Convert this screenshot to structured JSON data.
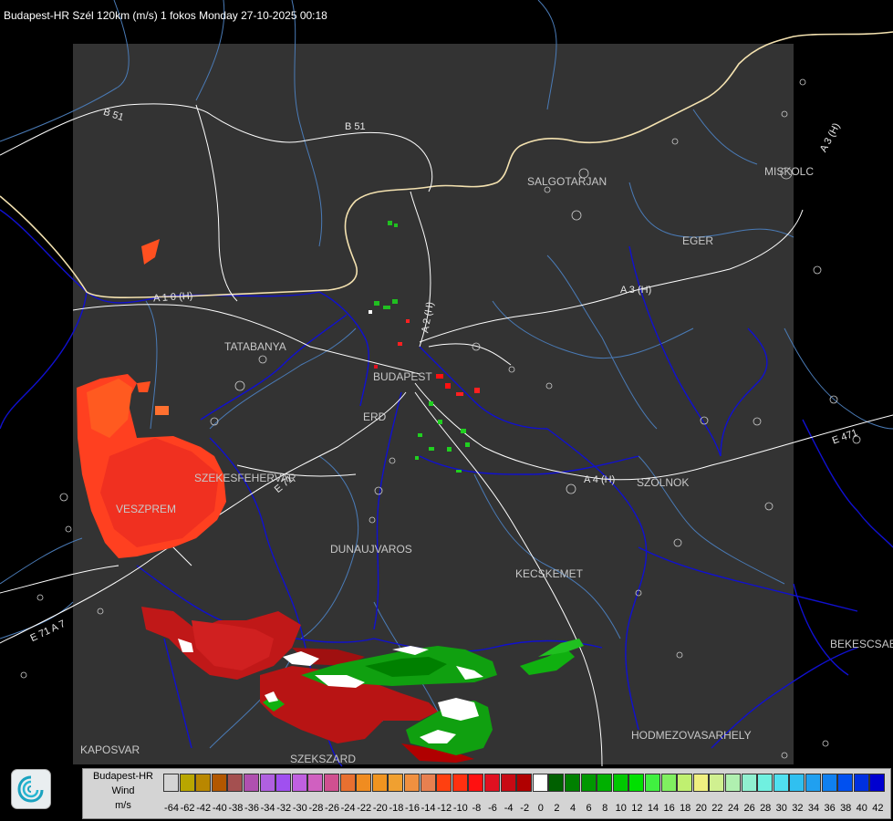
{
  "header": {
    "title": "Budapest-HR Szél 120km (m/s) 1 fokos Monday 27-10-2025 00:18"
  },
  "cities": [
    {
      "id": "salgotarjan",
      "label": "SALGOTARJAN"
    },
    {
      "id": "miskolc",
      "label": "MISKOLC"
    },
    {
      "id": "eger",
      "label": "EGER"
    },
    {
      "id": "tatabanya",
      "label": "TATABANYA"
    },
    {
      "id": "budapest",
      "label": "BUDAPEST"
    },
    {
      "id": "erd",
      "label": "ERD"
    },
    {
      "id": "szekesfehervar",
      "label": "SZEKESFEHERVAR"
    },
    {
      "id": "veszprem",
      "label": "VESZPREM"
    },
    {
      "id": "szolnok",
      "label": "SZOLNOK"
    },
    {
      "id": "dunaujvaros",
      "label": "DUNAUJVAROS"
    },
    {
      "id": "kecskemet",
      "label": "KECSKEMET"
    },
    {
      "id": "bekescsaba",
      "label": "BEKESCSABA"
    },
    {
      "id": "hodmezovasarhely",
      "label": "HODMEZOVASARHELY"
    },
    {
      "id": "kaposvar",
      "label": "KAPOSVAR"
    },
    {
      "id": "szekszard",
      "label": "SZEKSZARD"
    }
  ],
  "roads": [
    {
      "id": "b51-west",
      "label": "B 51"
    },
    {
      "id": "b51-north",
      "label": "B 51"
    },
    {
      "id": "a3-east",
      "label": "A 3 (H)"
    },
    {
      "id": "a3-ne",
      "label": "A 3 (H)"
    },
    {
      "id": "a2",
      "label": "A 2 (H)"
    },
    {
      "id": "a1",
      "label": "A 1 0 (H)"
    },
    {
      "id": "a4",
      "label": "A 4 (H)"
    },
    {
      "id": "e71",
      "label": "E 71"
    },
    {
      "id": "e471",
      "label": "E 471"
    },
    {
      "id": "e71sw",
      "label": "E 71 A 7"
    }
  ],
  "legend": {
    "name_lines": [
      "Budapest-HR",
      "Wind",
      "m/s"
    ],
    "bins": [
      {
        "value": "-64",
        "color": "#d4d4d4"
      },
      {
        "value": "-62",
        "color": "#b9a600"
      },
      {
        "value": "-42",
        "color": "#b98700"
      },
      {
        "value": "-40",
        "color": "#b25700"
      },
      {
        "value": "-38",
        "color": "#a45050"
      },
      {
        "value": "-36",
        "color": "#b050b0"
      },
      {
        "value": "-34",
        "color": "#b060e0"
      },
      {
        "value": "-32",
        "color": "#a050f0"
      },
      {
        "value": "-30",
        "color": "#c060e0"
      },
      {
        "value": "-28",
        "color": "#d060c0"
      },
      {
        "value": "-26",
        "color": "#d05090"
      },
      {
        "value": "-24",
        "color": "#e87030"
      },
      {
        "value": "-22",
        "color": "#f08c20"
      },
      {
        "value": "-20",
        "color": "#f09420"
      },
      {
        "value": "-18",
        "color": "#f0a030"
      },
      {
        "value": "-16",
        "color": "#f09040"
      },
      {
        "value": "-14",
        "color": "#e88050"
      },
      {
        "value": "-12",
        "color": "#ff4010"
      },
      {
        "value": "-10",
        "color": "#ff3010"
      },
      {
        "value": "-8",
        "color": "#ff1010"
      },
      {
        "value": "-6",
        "color": "#e01020"
      },
      {
        "value": "-4",
        "color": "#c80a14"
      },
      {
        "value": "-2",
        "color": "#b00000"
      },
      {
        "value": "0",
        "color": "#ffffff"
      },
      {
        "value": "2",
        "color": "#006000"
      },
      {
        "value": "4",
        "color": "#008000"
      },
      {
        "value": "6",
        "color": "#009800"
      },
      {
        "value": "8",
        "color": "#00b000"
      },
      {
        "value": "10",
        "color": "#00c800"
      },
      {
        "value": "12",
        "color": "#00e000"
      },
      {
        "value": "14",
        "color": "#40f040"
      },
      {
        "value": "16",
        "color": "#80f060"
      },
      {
        "value": "18",
        "color": "#c0f070"
      },
      {
        "value": "20",
        "color": "#f0f080"
      },
      {
        "value": "22",
        "color": "#d0f090"
      },
      {
        "value": "24",
        "color": "#b0f0b0"
      },
      {
        "value": "26",
        "color": "#90f0d0"
      },
      {
        "value": "28",
        "color": "#70f0e0"
      },
      {
        "value": "30",
        "color": "#50e0f0"
      },
      {
        "value": "32",
        "color": "#30c0f0"
      },
      {
        "value": "34",
        "color": "#20a0f0"
      },
      {
        "value": "36",
        "color": "#1080f0"
      },
      {
        "value": "38",
        "color": "#0050f0"
      },
      {
        "value": "40",
        "color": "#0030e0"
      },
      {
        "value": "42",
        "color": "#0000d0"
      }
    ]
  },
  "colors": {
    "background": "#000000",
    "radar_area": "#333333",
    "admin_borders": "#4a7bb7",
    "county_borders": "#0000cc",
    "roads": "#ffffff",
    "country_border": "#f0e0a0"
  }
}
